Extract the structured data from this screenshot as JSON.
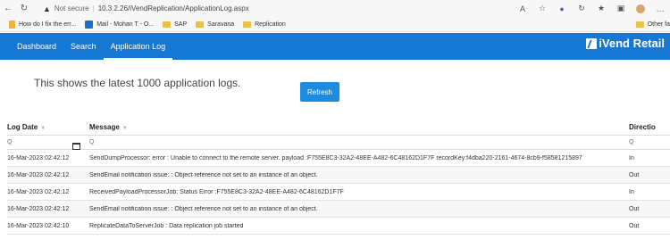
{
  "browser": {
    "security_label": "Not secure",
    "url": "10.3.2.26/iVendReplication/ApplicationLog.aspx",
    "bookmarks": [
      {
        "label": "How do I fix the err...",
        "icon": "page"
      },
      {
        "label": "Mail - Mohan T - O...",
        "icon": "outlook"
      },
      {
        "label": "SAP",
        "icon": "folder"
      },
      {
        "label": "Saravana",
        "icon": "folder"
      },
      {
        "label": "Replication",
        "icon": "folder"
      }
    ],
    "other_favorites": "Other fa"
  },
  "nav": {
    "tabs": [
      {
        "label": "Dashboard",
        "active": false
      },
      {
        "label": "Search",
        "active": false
      },
      {
        "label": "Application Log",
        "active": true
      }
    ],
    "logo": "iVend Retail"
  },
  "main": {
    "intro": "This shows the latest 1000 application logs.",
    "refresh_label": "Refresh"
  },
  "grid": {
    "columns": [
      "Log Date",
      "Message",
      "Directio"
    ],
    "rows": [
      {
        "date": "16-Mar-2023 02:42:12",
        "message": "SendDumpProcessor: error : Unable to connect to the remote server. payload :F755E8C3-32A2-48EE-A482-6C48162D1F7F recordKey:f4dba220-2161-4674-8cb9-f58581215897",
        "direction": "In"
      },
      {
        "date": "16-Mar-2023 02:42:12",
        "message": "SendEmail notification issue: : Object reference not set to an instance of an object.",
        "direction": "Out"
      },
      {
        "date": "16-Mar-2023 02:42:12",
        "message": "ReceivedPayloadProcessorJob: Status Error :F755E8C3-32A2-48EE-A482-6C48162D1F7F",
        "direction": "In"
      },
      {
        "date": "16-Mar-2023 02:42:12",
        "message": "SendEmail notification issue: : Object reference not set to an instance of an object.",
        "direction": "Out"
      },
      {
        "date": "16-Mar-2023 02:42:10",
        "message": "ReplicateDataToServerJob : Data replication job started",
        "direction": "Out"
      }
    ]
  }
}
